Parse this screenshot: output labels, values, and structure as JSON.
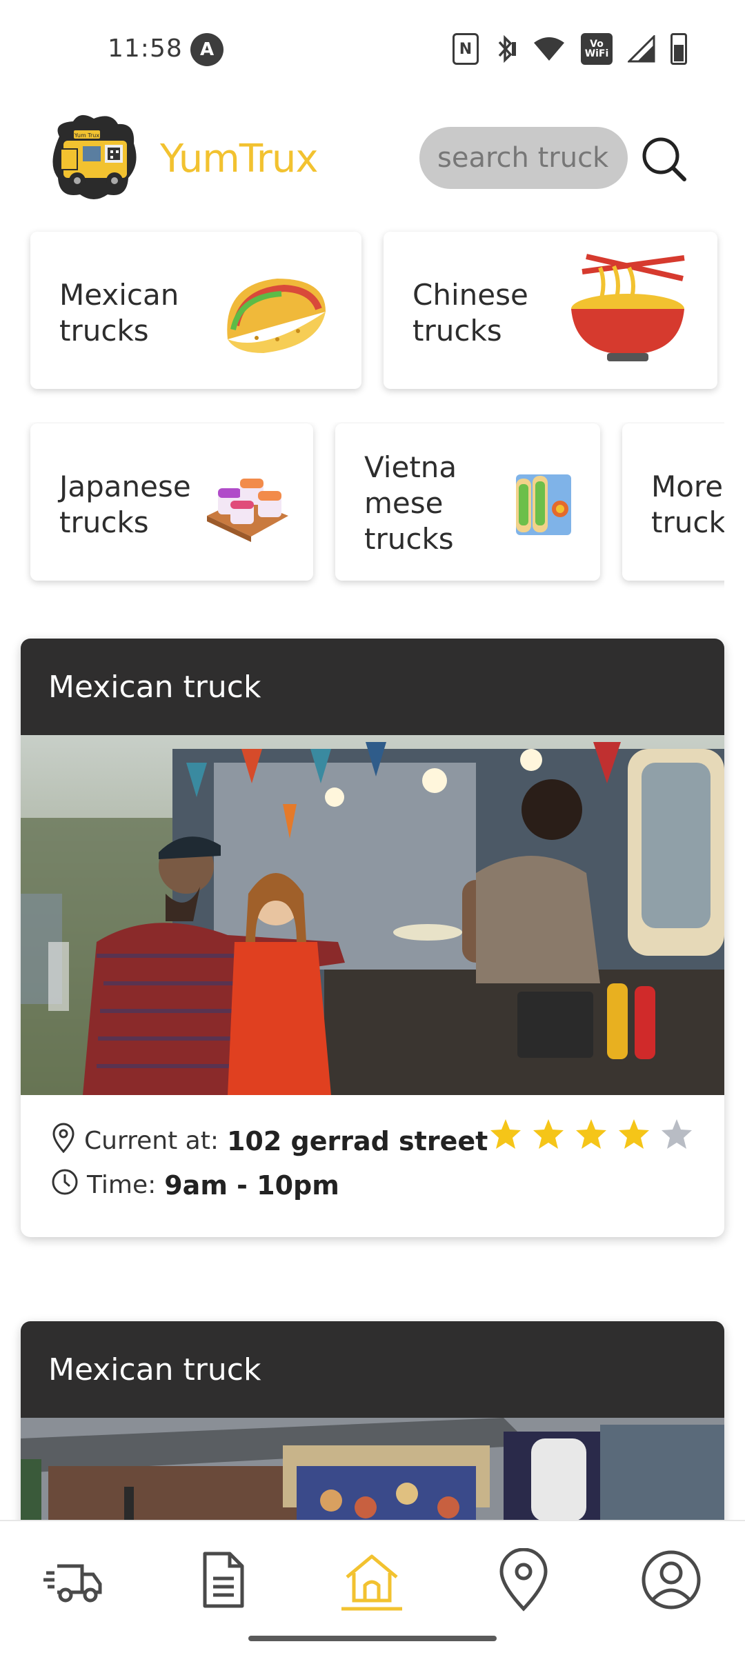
{
  "status_bar": {
    "time": "11:58",
    "notification_badge": "A",
    "nfc": "N",
    "wifi_calling": "Vo\nWiFi",
    "icons": [
      "nfc-icon",
      "bluetooth-icon",
      "wifi-icon",
      "vowifi-icon",
      "cell-signal-icon",
      "battery-icon"
    ]
  },
  "header": {
    "brand": "YumTrux",
    "logo_sign_text": "Yum Trux",
    "search_placeholder": "search truck"
  },
  "categories": [
    {
      "label": "Mexican\ntrucks",
      "icon": "taco-icon"
    },
    {
      "label": "Chinese\ntrucks",
      "icon": "noodle-bowl-icon"
    },
    {
      "label": "Japanese\ntrucks",
      "icon": "sushi-icon"
    },
    {
      "label": "Vietna\nmese\ntrucks",
      "icon": "spring-rolls-icon"
    },
    {
      "label": "More\ntrucks",
      "icon": ""
    }
  ],
  "trucks": [
    {
      "title": "Mexican truck",
      "location_label": "Current at:",
      "location_value": "102 gerrad street",
      "time_label": "Time:",
      "time_value": "9am - 10pm",
      "rating": 4,
      "rating_max": 5
    },
    {
      "title": "Mexican truck"
    }
  ],
  "bottom_nav": [
    {
      "name": "nav-trucks",
      "icon": "truck-icon",
      "active": false
    },
    {
      "name": "nav-orders",
      "icon": "document-icon",
      "active": false
    },
    {
      "name": "nav-home",
      "icon": "home-icon",
      "active": true
    },
    {
      "name": "nav-map",
      "icon": "location-pin-icon",
      "active": false
    },
    {
      "name": "nav-profile",
      "icon": "profile-icon",
      "active": false
    }
  ],
  "colors": {
    "brand": "#f2c230",
    "star_on": "#f5c518",
    "star_off": "#b8bcc4",
    "card_header": "#2f2e2e",
    "nav_active": "#f2c230",
    "nav_inactive": "#4a4a4a"
  }
}
